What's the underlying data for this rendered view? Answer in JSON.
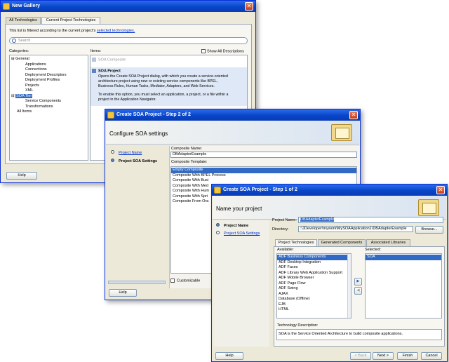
{
  "gallery": {
    "title": "New Gallery",
    "tabs": [
      "All Technologies",
      "Current Project Technologies"
    ],
    "filter_text": "This list is filtered according to the current project's",
    "filter_link": "selected technologies.",
    "search_placeholder": "Search",
    "categories_label": "Categories:",
    "items_label": "Items:",
    "show_all_label": "Show All Descriptions",
    "categories": [
      "General",
      "Applications",
      "Connections",
      "Deployment Descriptors",
      "Deployment Profiles",
      "Projects",
      "XML",
      "SOA Tier",
      "Service Components",
      "Transformations",
      "All Items"
    ],
    "items": [
      "SOA Composite",
      "SOA Project"
    ],
    "soa_desc_1": "Opens the Create SOA Project dialog, with which you create a service-oriented",
    "soa_desc_2": "architecture project using new or existing service components like BPEL,",
    "soa_desc_3": "Business Rules, Human Tasks, Mediator, Adapters, and Web Services.",
    "soa_desc_4": "To enable this option, you must select an application, a project, or a file within a",
    "soa_desc_5": "project in the Application Navigator.",
    "help": "Help"
  },
  "step2": {
    "title": "Create SOA Project - Step 2 of 2",
    "heading": "Configure SOA settings",
    "nav": [
      "Project Name",
      "Project SOA Settings"
    ],
    "composite_name_label": "Composite Name:",
    "composite_name_value": "DBAdapterExample",
    "template_label": "Composite Template:",
    "templates": [
      "Empty Composite",
      "Composite With BPEL Process",
      "Composite With Busi",
      "Composite With Med",
      "Composite With Hum",
      "Composite With Spri",
      "Composite From Ora"
    ],
    "customizable_label": "Customizable",
    "help": "Help"
  },
  "step1": {
    "title": "Create SOA Project - Step 1 of 2",
    "heading": "Name your project",
    "nav": [
      "Project Name",
      "Project SOA Settings"
    ],
    "project_name_label": "Project Name:",
    "project_name_value": "DBAdapterExample",
    "directory_label": "Directory:",
    "directory_value": ":\\JDeveloper\\mywork\\MySOAApplication1\\DBAdapterExample",
    "browse": "Browse...",
    "tabs": [
      "Project Technologies",
      "Generated Components",
      "Associated Libraries"
    ],
    "available_label": "Available:",
    "selected_label": "Selected:",
    "available": [
      "ADF Business Components",
      "ADF Desktop Integration",
      "ADF Faces",
      "ADF Library Web Application Support",
      "ADF Mobile Browser",
      "ADF Page Flow",
      "ADF Swing",
      "AJAX",
      "Database (Offline)",
      "EJB",
      "HTML"
    ],
    "selected": [
      "SOA"
    ],
    "tech_desc_label": "Technology Description:",
    "tech_desc_value": "SOA is the Service Oriented Architecture to build composite applications.",
    "help": "Help",
    "back": "< Back",
    "next": "Next >",
    "finish": "Finish",
    "cancel": "Cancel"
  }
}
